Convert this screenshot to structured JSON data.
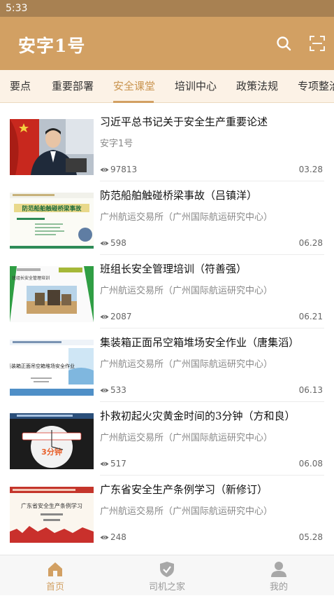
{
  "status_bar": {
    "time": "5:33"
  },
  "header": {
    "title": "安字1号",
    "search_icon": "search-icon",
    "scan_icon": "scan-icon"
  },
  "tabs": [
    {
      "label": "要点",
      "active": false
    },
    {
      "label": "重要部署",
      "active": false
    },
    {
      "label": "安全课堂",
      "active": true
    },
    {
      "label": "培训中心",
      "active": false
    },
    {
      "label": "政策法规",
      "active": false
    },
    {
      "label": "专项整治",
      "active": false
    }
  ],
  "articles": [
    {
      "title": "习近平总书记关于安全生产重要论述",
      "source": "安字1号",
      "views": "97813",
      "date": "03.28",
      "thumb_text": ""
    },
    {
      "title": "防范船舶触碰桥梁事故（吕镇洋）",
      "source": "广州航运交易所（广州国际航运研究中心）",
      "views": "598",
      "date": "06.28",
      "thumb_text": "防范船舶触碰桥梁事故"
    },
    {
      "title": "班组长安全管理培训（符善强）",
      "source": "广州航运交易所（广州国际航运研究中心）",
      "views": "2087",
      "date": "06.21",
      "thumb_text": "班组长安全管理培训"
    },
    {
      "title": "集装箱正面吊空箱堆场安全作业（唐集滔）",
      "source": "广州航运交易所（广州国际航运研究中心）",
      "views": "533",
      "date": "06.13",
      "thumb_text": "集装箱正面吊空箱堆场安全作业"
    },
    {
      "title": "扑救初起火灾黄金时间的3分钟（方和良）",
      "source": "广州航运交易所（广州国际航运研究中心）",
      "views": "517",
      "date": "06.08",
      "thumb_text": "3分钟"
    },
    {
      "title": "广东省安全生产条例学习（新修订）",
      "source": "广州航运交易所（广州国际航运研究中心）",
      "views": "248",
      "date": "05.28",
      "thumb_text": "广东省安全生产条例学习"
    }
  ],
  "bottom_nav": [
    {
      "label": "首页",
      "icon": "home-icon",
      "active": true
    },
    {
      "label": "司机之家",
      "icon": "shield-check-icon",
      "active": false
    },
    {
      "label": "我的",
      "icon": "user-icon",
      "active": false
    }
  ],
  "colors": {
    "header": "#d2a063",
    "status_bar": "#a88152",
    "accent": "#c9944f",
    "tabs_bg": "#fcf2e6"
  }
}
